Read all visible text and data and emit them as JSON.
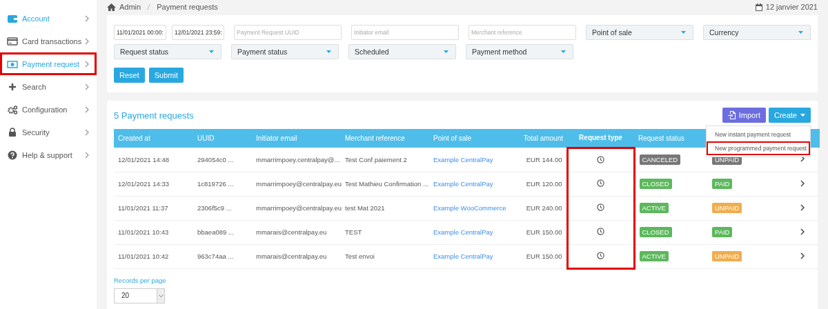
{
  "sidebar": {
    "items": [
      {
        "label": "Account",
        "active": true,
        "highlighted": false
      },
      {
        "label": "Card transactions",
        "active": false,
        "highlighted": false
      },
      {
        "label": "Payment request",
        "active": true,
        "highlighted": true
      },
      {
        "label": "Search",
        "active": false,
        "highlighted": false
      },
      {
        "label": "Configuration",
        "active": false,
        "highlighted": false
      },
      {
        "label": "Security",
        "active": false,
        "highlighted": false
      },
      {
        "label": "Help & support",
        "active": false,
        "highlighted": false
      }
    ]
  },
  "breadcrumb": [
    "Admin",
    "Payment requests"
  ],
  "date": "12 janvier 2021",
  "filters": {
    "fields": [
      {
        "kind": "date",
        "value": "11/01/2021 00:00:"
      },
      {
        "kind": "date",
        "value": "12/01/2021 23:59:"
      },
      {
        "kind": "text",
        "placeholder": "Payment Request UUID"
      },
      {
        "kind": "text",
        "placeholder": "Initiator email"
      },
      {
        "kind": "text",
        "placeholder": "Merchant reference"
      },
      {
        "kind": "select",
        "value": "Point of sale"
      },
      {
        "kind": "select",
        "value": "Currency"
      },
      {
        "kind": "select",
        "value": "Request status"
      },
      {
        "kind": "select",
        "value": "Payment status"
      },
      {
        "kind": "select",
        "value": "Scheduled"
      },
      {
        "kind": "select",
        "value": "Payment method"
      }
    ],
    "buttons": [
      "Reset",
      "Submit"
    ]
  },
  "list": {
    "title": "5 Payment requests",
    "import_button": "Import",
    "create_button": "Create",
    "create_menu": [
      {
        "label": "New instant payment request",
        "highlighted": false
      },
      {
        "label": "New programmed payment request",
        "highlighted": true
      }
    ],
    "table": {
      "columns": [
        {
          "label": "Created at",
          "highlighted": false
        },
        {
          "label": "UUID",
          "highlighted": false
        },
        {
          "label": "Initiator email",
          "highlighted": false
        },
        {
          "label": "Merchant reference",
          "highlighted": false
        },
        {
          "label": "Point of sale",
          "highlighted": false
        },
        {
          "label": "Total amount",
          "highlighted": false
        },
        {
          "label": "Request type",
          "highlighted": true
        },
        {
          "label": "Request status",
          "highlighted": false
        }
      ],
      "rows": [
        {
          "created_at": "12/01/2021 14:48",
          "uuid": "294054c0 ...",
          "email": "mmarrimpoey.centralpay@...",
          "reference": "Test Conf paiement 2",
          "point_of_sale": "Example CentralPay",
          "amount": "EUR 144.00",
          "request_status": {
            "text": "CANCELED",
            "color": "#777777"
          },
          "payment_status": {
            "text": "UNPAID",
            "color": "#777777"
          }
        },
        {
          "created_at": "12/01/2021 14:33",
          "uuid": "1c819726 ...",
          "email": "mmarrimpoey@centralpay.eu",
          "reference": "Test Mathieu Confirmation ...",
          "point_of_sale": "Example CentralPay",
          "amount": "EUR 120.00",
          "request_status": {
            "text": "CLOSED",
            "color": "#5cb85c"
          },
          "payment_status": {
            "text": "PAID",
            "color": "#5cb85c"
          }
        },
        {
          "created_at": "11/01/2021 11:37",
          "uuid": "2306f5c9 ...",
          "email": "mmarrimpoey@centralpay.eu",
          "reference": "test Mat 2021",
          "point_of_sale": "Example WooCommerce",
          "amount": "EUR 240.00",
          "request_status": {
            "text": "ACTIVE",
            "color": "#5cb85c"
          },
          "payment_status": {
            "text": "UNPAID",
            "color": "#f0ad4e"
          }
        },
        {
          "created_at": "11/01/2021 10:43",
          "uuid": "bbaea089 ...",
          "email": "mmarais@centralpay.eu",
          "reference": "TEST",
          "point_of_sale": "Example CentralPay",
          "amount": "EUR 150.00",
          "request_status": {
            "text": "CLOSED",
            "color": "#5cb85c"
          },
          "payment_status": {
            "text": "PAID",
            "color": "#5cb85c"
          }
        },
        {
          "created_at": "11/01/2021 10:42",
          "uuid": "963c74aa ...",
          "email": "mmarais@centralpay.eu",
          "reference": "Test envoi",
          "point_of_sale": "Example CentralPay",
          "amount": "EUR 150.00",
          "request_status": {
            "text": "ACTIVE",
            "color": "#5cb85c"
          },
          "payment_status": {
            "text": "UNPAID",
            "color": "#f0ad4e"
          }
        }
      ]
    },
    "records_label": "Records per page",
    "records_value": "20"
  }
}
